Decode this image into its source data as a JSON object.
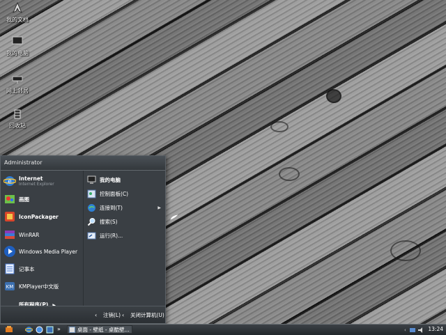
{
  "desktop": {
    "icons": [
      {
        "label": "我的文档",
        "icon": "my-documents-icon"
      },
      {
        "label": "我的电脑",
        "icon": "my-computer-icon"
      },
      {
        "label": "网上邻居",
        "icon": "network-places-icon"
      },
      {
        "label": "回收站",
        "icon": "recycle-bin-icon"
      }
    ]
  },
  "start_menu": {
    "user": "Administrator",
    "pinned": [
      {
        "label": "Internet",
        "sub": "Internet Explorer",
        "icon": "internet-explorer-icon"
      },
      {
        "label": "画图",
        "icon": "paint-icon"
      },
      {
        "label": "IconPackager",
        "icon": "iconpackager-icon"
      },
      {
        "label": "WinRAR",
        "icon": "winrar-icon"
      },
      {
        "label": "Windows Media Player",
        "icon": "media-player-icon"
      },
      {
        "label": "记事本",
        "icon": "notepad-icon"
      },
      {
        "label": "KMPlayer中文版",
        "icon": "kmplayer-icon"
      }
    ],
    "all_programs": "所有程序(P)",
    "right": [
      {
        "label": "我的电脑",
        "icon": "my-computer-icon"
      },
      {
        "label": "控制面板(C)",
        "icon": "control-panel-icon"
      },
      {
        "label": "连接到(T)",
        "icon": "connect-to-icon"
      },
      {
        "label": "搜索(S)",
        "icon": "search-icon"
      },
      {
        "label": "运行(R)...",
        "icon": "run-icon"
      }
    ],
    "logoff": "注销(L)",
    "shutdown": "关闭计算机(U)"
  },
  "taskbar": {
    "task_label": "桌面 - 壁纸 - 桌酷壁...",
    "clock": "13:24"
  },
  "colors": {
    "menu_bg": "#3a3f44",
    "taskbar": "#2b3035"
  }
}
